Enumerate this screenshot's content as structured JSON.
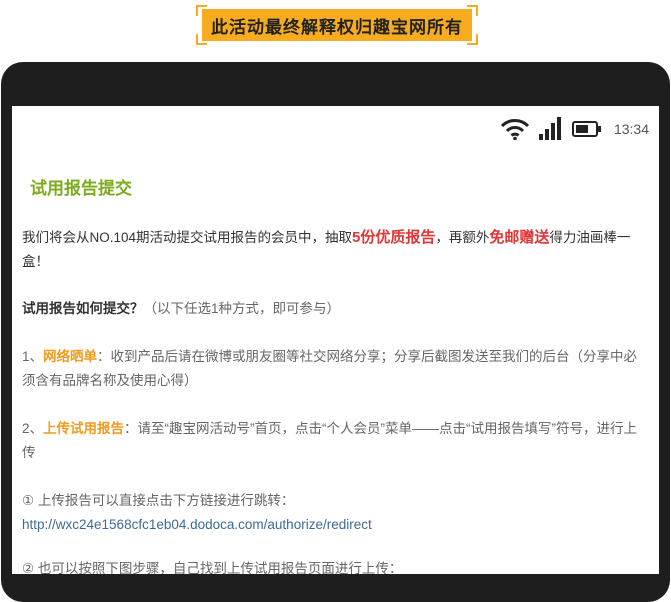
{
  "banner": {
    "text": "此活动最终解释权归趣宝网所有"
  },
  "status_bar": {
    "time": "13:34"
  },
  "content": {
    "title": "试用报告提交",
    "intro": {
      "p1": "我们将会从NO.104期活动提交试用报告的会员中，抽取",
      "hl1": "5份优质报告",
      "p2": "，再额外",
      "hl2": "免邮赠送",
      "p3": "得力油画棒一盒！"
    },
    "howto": {
      "label": "试用报告如何提交？",
      "note": "（以下任选1种方式，即可参与）"
    },
    "method1": {
      "num": "1、",
      "label": "网络晒单",
      "text": "：收到产品后请在微博或朋友圈等社交网络分享；分享后截图发送至我们的后台（分享中必须含有品牌名称及使用心得）"
    },
    "method2": {
      "num": "2、",
      "label": "上传试用报告",
      "text": "：请至“趣宝网活动号”首页，点击“个人会员”菜单——点击“试用报告填写”符号，进行上传"
    },
    "step1": {
      "text": "① 上传报告可以直接点击下方链接进行跳转：",
      "link": "http://wxc24e1568cfc1eb04.dodoca.com/authorize/redirect"
    },
    "step2": {
      "text": "② 也可以按照下图步骤，自己找到上传试用报告页面进行上传："
    }
  }
}
